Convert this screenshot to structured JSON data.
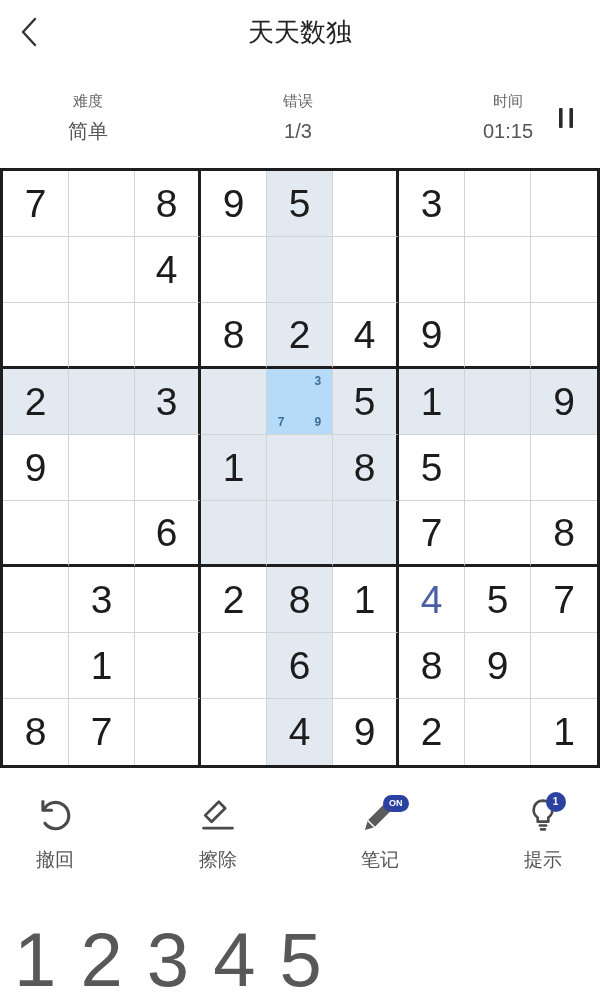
{
  "header": {
    "title": "天天数独"
  },
  "stats": [
    {
      "label": "难度",
      "value": "简单"
    },
    {
      "label": "错误",
      "value": "1/3"
    },
    {
      "label": "时间",
      "value": "01:15"
    }
  ],
  "grid": {
    "rows": [
      {
        "cells": [
          {
            "kind": "given",
            "value": "7",
            "highlighted": false,
            "selected": false
          },
          {
            "kind": "empty",
            "highlighted": false,
            "selected": false
          },
          {
            "kind": "given",
            "value": "8",
            "highlighted": false,
            "selected": false
          },
          {
            "kind": "given",
            "value": "9",
            "highlighted": false,
            "selected": false
          },
          {
            "kind": "given",
            "value": "5",
            "highlighted": true,
            "selected": false
          },
          {
            "kind": "empty",
            "highlighted": false,
            "selected": false
          },
          {
            "kind": "given",
            "value": "3",
            "highlighted": false,
            "selected": false
          },
          {
            "kind": "empty",
            "highlighted": false,
            "selected": false
          },
          {
            "kind": "empty",
            "highlighted": false,
            "selected": false
          }
        ]
      },
      {
        "cells": [
          {
            "kind": "empty",
            "highlighted": false,
            "selected": false
          },
          {
            "kind": "empty",
            "highlighted": false,
            "selected": false
          },
          {
            "kind": "given",
            "value": "4",
            "highlighted": false,
            "selected": false
          },
          {
            "kind": "empty",
            "highlighted": false,
            "selected": false
          },
          {
            "kind": "empty",
            "highlighted": true,
            "selected": false
          },
          {
            "kind": "empty",
            "highlighted": false,
            "selected": false
          },
          {
            "kind": "empty",
            "highlighted": false,
            "selected": false
          },
          {
            "kind": "empty",
            "highlighted": false,
            "selected": false
          },
          {
            "kind": "empty",
            "highlighted": false,
            "selected": false
          }
        ]
      },
      {
        "cells": [
          {
            "kind": "empty",
            "highlighted": false,
            "selected": false
          },
          {
            "kind": "empty",
            "highlighted": false,
            "selected": false
          },
          {
            "kind": "empty",
            "highlighted": false,
            "selected": false
          },
          {
            "kind": "given",
            "value": "8",
            "highlighted": false,
            "selected": false
          },
          {
            "kind": "given",
            "value": "2",
            "highlighted": true,
            "selected": false
          },
          {
            "kind": "given",
            "value": "4",
            "highlighted": false,
            "selected": false
          },
          {
            "kind": "given",
            "value": "9",
            "highlighted": false,
            "selected": false
          },
          {
            "kind": "empty",
            "highlighted": false,
            "selected": false
          },
          {
            "kind": "empty",
            "highlighted": false,
            "selected": false
          }
        ]
      },
      {
        "cells": [
          {
            "kind": "given",
            "value": "2",
            "highlighted": true,
            "selected": false
          },
          {
            "kind": "empty",
            "highlighted": true,
            "selected": false
          },
          {
            "kind": "given",
            "value": "3",
            "highlighted": true,
            "selected": false
          },
          {
            "kind": "empty",
            "highlighted": true,
            "selected": false
          },
          {
            "kind": "notes",
            "notes": [
              {
                "kind": "top-right",
                "text": "3"
              },
              {
                "kind": "bottom-left",
                "text": "7"
              },
              {
                "kind": "bottom-right",
                "text": "9"
              }
            ],
            "highlighted": true,
            "selected": true
          },
          {
            "kind": "given",
            "value": "5",
            "highlighted": true,
            "selected": false
          },
          {
            "kind": "given",
            "value": "1",
            "highlighted": true,
            "selected": false
          },
          {
            "kind": "empty",
            "highlighted": true,
            "selected": false
          },
          {
            "kind": "given",
            "value": "9",
            "highlighted": true,
            "selected": false
          }
        ]
      },
      {
        "cells": [
          {
            "kind": "given",
            "value": "9",
            "highlighted": false,
            "selected": false
          },
          {
            "kind": "empty",
            "highlighted": false,
            "selected": false
          },
          {
            "kind": "empty",
            "highlighted": false,
            "selected": false
          },
          {
            "kind": "given",
            "value": "1",
            "highlighted": true,
            "selected": false
          },
          {
            "kind": "empty",
            "highlighted": true,
            "selected": false
          },
          {
            "kind": "given",
            "value": "8",
            "highlighted": true,
            "selected": false
          },
          {
            "kind": "given",
            "value": "5",
            "highlighted": false,
            "selected": false
          },
          {
            "kind": "empty",
            "highlighted": false,
            "selected": false
          },
          {
            "kind": "empty",
            "highlighted": false,
            "selected": false
          }
        ]
      },
      {
        "cells": [
          {
            "kind": "empty",
            "highlighted": false,
            "selected": false
          },
          {
            "kind": "empty",
            "highlighted": false,
            "selected": false
          },
          {
            "kind": "given",
            "value": "6",
            "highlighted": false,
            "selected": false
          },
          {
            "kind": "empty",
            "highlighted": true,
            "selected": false
          },
          {
            "kind": "empty",
            "highlighted": true,
            "selected": false
          },
          {
            "kind": "empty",
            "highlighted": true,
            "selected": false
          },
          {
            "kind": "given",
            "value": "7",
            "highlighted": false,
            "selected": false
          },
          {
            "kind": "empty",
            "highlighted": false,
            "selected": false
          },
          {
            "kind": "given",
            "value": "8",
            "highlighted": false,
            "selected": false
          }
        ]
      },
      {
        "cells": [
          {
            "kind": "empty",
            "highlighted": false,
            "selected": false
          },
          {
            "kind": "given",
            "value": "3",
            "highlighted": false,
            "selected": false
          },
          {
            "kind": "empty",
            "highlighted": false,
            "selected": false
          },
          {
            "kind": "given",
            "value": "2",
            "highlighted": false,
            "selected": false
          },
          {
            "kind": "given",
            "value": "8",
            "highlighted": true,
            "selected": false
          },
          {
            "kind": "given",
            "value": "1",
            "highlighted": false,
            "selected": false
          },
          {
            "kind": "entered",
            "value": "4",
            "highlighted": false,
            "selected": false
          },
          {
            "kind": "given",
            "value": "5",
            "highlighted": false,
            "selected": false
          },
          {
            "kind": "given",
            "value": "7",
            "highlighted": false,
            "selected": false
          }
        ]
      },
      {
        "cells": [
          {
            "kind": "empty",
            "highlighted": false,
            "selected": false
          },
          {
            "kind": "given",
            "value": "1",
            "highlighted": false,
            "selected": false
          },
          {
            "kind": "empty",
            "highlighted": false,
            "selected": false
          },
          {
            "kind": "empty",
            "highlighted": false,
            "selected": false
          },
          {
            "kind": "given",
            "value": "6",
            "highlighted": true,
            "selected": false
          },
          {
            "kind": "empty",
            "highlighted": false,
            "selected": false
          },
          {
            "kind": "given",
            "value": "8",
            "highlighted": false,
            "selected": false
          },
          {
            "kind": "given",
            "value": "9",
            "highlighted": false,
            "selected": false
          },
          {
            "kind": "empty",
            "highlighted": false,
            "selected": false
          }
        ]
      },
      {
        "cells": [
          {
            "kind": "given",
            "value": "8",
            "highlighted": false,
            "selected": false
          },
          {
            "kind": "given",
            "value": "7",
            "highlighted": false,
            "selected": false
          },
          {
            "kind": "empty",
            "highlighted": false,
            "selected": false
          },
          {
            "kind": "empty",
            "highlighted": false,
            "selected": false
          },
          {
            "kind": "given",
            "value": "4",
            "highlighted": true,
            "selected": false
          },
          {
            "kind": "given",
            "value": "9",
            "highlighted": false,
            "selected": false
          },
          {
            "kind": "given",
            "value": "2",
            "highlighted": false,
            "selected": false
          },
          {
            "kind": "empty",
            "highlighted": false,
            "selected": false
          },
          {
            "kind": "given",
            "value": "1",
            "highlighted": false,
            "selected": false
          }
        ]
      }
    ]
  },
  "tools": [
    {
      "kind": "undo",
      "label": "撤回"
    },
    {
      "kind": "erase",
      "label": "擦除"
    },
    {
      "kind": "notes",
      "label": "笔记",
      "badge": "ON"
    },
    {
      "kind": "hint",
      "label": "提示",
      "badge": "1"
    }
  ],
  "numpad": [
    "1",
    "2",
    "3",
    "4",
    "5"
  ]
}
